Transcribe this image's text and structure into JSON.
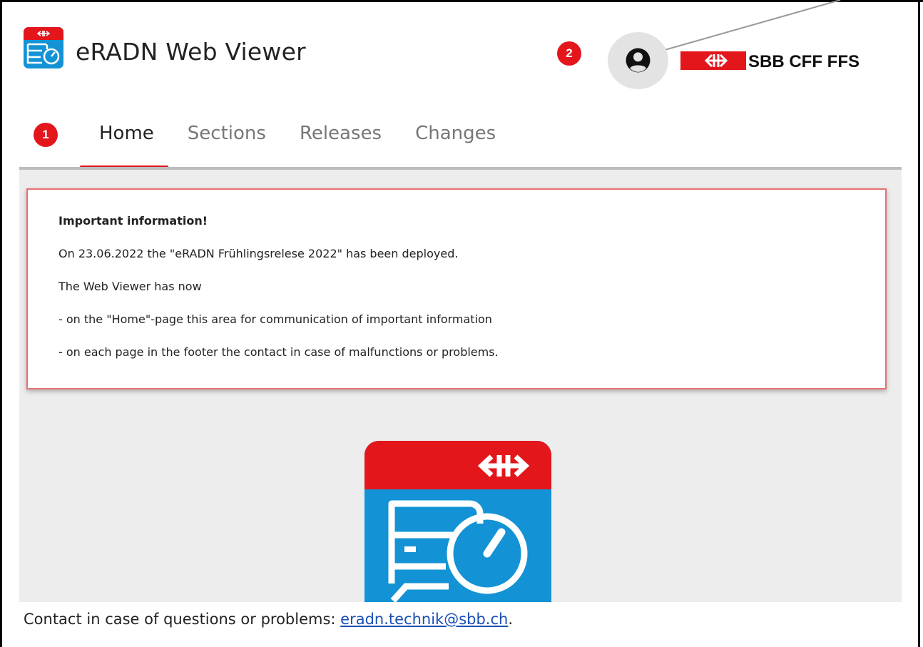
{
  "header": {
    "app_title": "eRADN Web Viewer",
    "brand_text": "SBB CFF FFS",
    "user_icon": "account-circle-icon",
    "annotation_badges": [
      "1",
      "2"
    ]
  },
  "nav": {
    "tabs": [
      {
        "label": "Home",
        "active": true
      },
      {
        "label": "Sections",
        "active": false
      },
      {
        "label": "Releases",
        "active": false
      },
      {
        "label": "Changes",
        "active": false
      }
    ]
  },
  "info": {
    "title": "Important information!",
    "lines": [
      "On 23.06.2022 the \"eRADN Frühlingsrelese 2022\" has been deployed.",
      "The Web Viewer has now",
      "- on the \"Home\"-page this area for communication of important information",
      "- on each page in the footer the contact in case of malfunctions or problems."
    ]
  },
  "footer": {
    "text": "Contact in case of questions or problems: ",
    "email": "eradn.technik@sbb.ch",
    "suffix": "."
  },
  "colors": {
    "sbb_red": "#e3161c",
    "logo_blue": "#1393d5",
    "panel_bg": "#ededed",
    "info_border": "#e57373",
    "link": "#1a4fb5"
  }
}
